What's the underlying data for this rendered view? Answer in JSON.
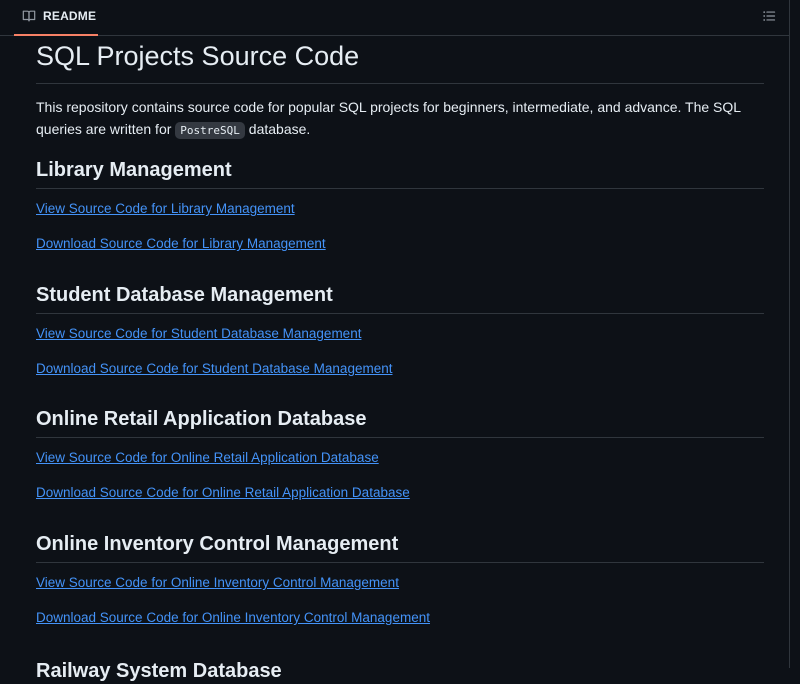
{
  "tab": {
    "label": "README"
  },
  "readme": {
    "title": "SQL Projects Source Code",
    "intro_before": "This repository contains source code for popular SQL projects for beginners, intermediate, and advance. The SQL queries are written for ",
    "intro_code": "PostreSQL",
    "intro_after": " database.",
    "sections": [
      {
        "heading": "Library Management",
        "view_link": "View Source Code for Library Management",
        "download_link": "Download Source Code for Library Management"
      },
      {
        "heading": "Student Database Management",
        "view_link": "View Source Code for Student Database Management",
        "download_link": "Download Source Code for Student Database Management"
      },
      {
        "heading": "Online Retail Application Database",
        "view_link": "View Source Code for Online Retail Application Database",
        "download_link": "Download Source Code for Online Retail Application Database"
      },
      {
        "heading": "Online Inventory Control Management",
        "view_link": "View Source Code for Online Inventory Control Management",
        "download_link": "Download Source Code for Online Inventory Control Management"
      }
    ],
    "partial_heading": "Railway System Database"
  },
  "icons": {
    "tab_icon": "book-icon",
    "toc_icon": "list-unordered-icon"
  },
  "colors": {
    "background": "#0d1117",
    "text": "#e6edf3",
    "link": "#4493f8",
    "border": "#30363d",
    "tab_underline": "#f78166"
  }
}
